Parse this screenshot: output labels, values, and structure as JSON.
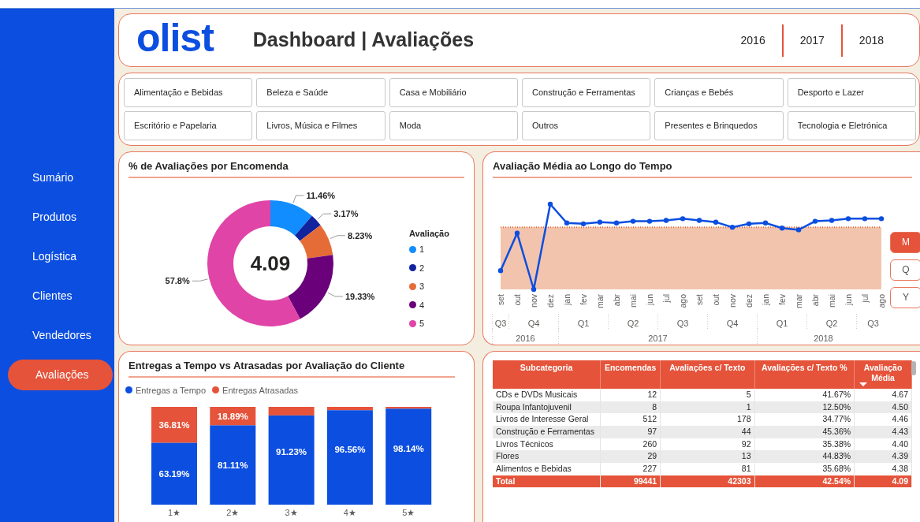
{
  "sidebar": {
    "items": [
      {
        "label": "Sumário",
        "selected": false
      },
      {
        "label": "Produtos",
        "selected": false
      },
      {
        "label": "Logística",
        "selected": false
      },
      {
        "label": "Clientes",
        "selected": false
      },
      {
        "label": "Vendedores",
        "selected": false
      },
      {
        "label": "Avaliações",
        "selected": true
      }
    ]
  },
  "header": {
    "logo": "olist",
    "title": "Dashboard | Avaliações",
    "years": [
      "2016",
      "2017",
      "2018"
    ]
  },
  "categories": [
    "Alimentação e Bebidas",
    "Beleza e Saúde",
    "Casa e Mobiliário",
    "Construção e Ferramentas",
    "Crianças e Bebés",
    "Desporto e Lazer",
    "Escritório e Papelaria",
    "Livros, Música e Filmes",
    "Moda",
    "Outros",
    "Presentes e Brinquedos",
    "Tecnologia e Eletrónica"
  ],
  "reviews_by_order": {
    "title": "% de Avaliações por Encomenda",
    "center_value": "4.09",
    "chart_data": {
      "type": "donut",
      "categories": [
        "1",
        "2",
        "3",
        "4",
        "5"
      ],
      "series": [
        {
          "name": "Avaliação",
          "values": [
            11.46,
            3.17,
            8.23,
            19.33,
            57.8
          ]
        }
      ],
      "colors": [
        "#118dff",
        "#12239e",
        "#e66c37",
        "#6b007b",
        "#e044a7"
      ],
      "value_labels": [
        "11.46%",
        "3.17%",
        "8.23%",
        "19.33%",
        "57.8%"
      ]
    }
  },
  "rating_over_time": {
    "title": "Avaliação Média ao Longo do Tempo",
    "axis": [
      {
        "label": "2016",
        "children": [
          {
            "label": "Q3",
            "children": [
              {
                "label": "set"
              }
            ]
          },
          {
            "label": "Q4",
            "children": [
              {
                "label": "out"
              },
              {
                "label": "nov"
              },
              {
                "label": "dez"
              }
            ]
          }
        ]
      },
      {
        "label": "2017",
        "children": [
          {
            "label": "Q1",
            "children": [
              {
                "label": "jan"
              },
              {
                "label": "fev"
              },
              {
                "label": "mar"
              }
            ]
          },
          {
            "label": "Q2",
            "children": [
              {
                "label": "abr"
              },
              {
                "label": "mai"
              },
              {
                "label": "jun"
              }
            ]
          },
          {
            "label": "Q3",
            "children": [
              {
                "label": "jul"
              },
              {
                "label": "ago"
              },
              {
                "label": "set"
              }
            ]
          },
          {
            "label": "Q4",
            "children": [
              {
                "label": "out"
              },
              {
                "label": "nov"
              },
              {
                "label": "dez"
              }
            ]
          }
        ]
      },
      {
        "label": "2018",
        "children": [
          {
            "label": "Q1",
            "children": [
              {
                "label": "jan"
              },
              {
                "label": "fev"
              },
              {
                "label": "mar"
              }
            ]
          },
          {
            "label": "Q2",
            "children": [
              {
                "label": "abr"
              },
              {
                "label": "mai"
              },
              {
                "label": "jun"
              }
            ]
          },
          {
            "label": "Q3",
            "children": [
              {
                "label": "jul"
              },
              {
                "label": "ago"
              }
            ]
          }
        ]
      }
    ],
    "granularity": [
      {
        "label": "M",
        "selected": true
      },
      {
        "label": "Q",
        "selected": false
      },
      {
        "label": "Y",
        "selected": false
      }
    ]
  },
  "deliveries_by_rating": {
    "title": "Entregas a Tempo vs Atrasadas por Avaliação do Cliente",
    "chart_data": {
      "type": "bar",
      "stacked": true,
      "categories": [
        "1★",
        "2★",
        "3★",
        "4★",
        "5★"
      ],
      "series": [
        {
          "name": "Entregas a Tempo",
          "color": "#0b4ee0",
          "values": [
            63.19,
            81.11,
            91.23,
            96.56,
            98.14
          ],
          "value_labels": [
            "63.19%",
            "81.11%",
            "91.23%",
            "96.56%",
            "98.14%"
          ]
        },
        {
          "name": "Entregas Atrasadas",
          "color": "#e5533a",
          "values": [
            36.81,
            18.89,
            8.77,
            3.44,
            1.86
          ],
          "value_labels": [
            "36.81%",
            "18.89%",
            null,
            null,
            null
          ]
        }
      ]
    }
  },
  "subcategory_table": {
    "columns": [
      {
        "label": "Subcategoria",
        "sorted": false
      },
      {
        "label": "Encomendas",
        "sorted": false
      },
      {
        "label": "Avaliações c/ Texto",
        "sorted": false
      },
      {
        "label": "Avaliações c/ Texto %",
        "sorted": false
      },
      {
        "label": "Avaliação Média",
        "sorted": true
      }
    ],
    "rows": [
      [
        "CDs e DVDs Musicais",
        "12",
        "5",
        "41.67%",
        "4.67"
      ],
      [
        "Roupa Infantojuvenil",
        "8",
        "1",
        "12.50%",
        "4.50"
      ],
      [
        "Livros de Interesse Geral",
        "512",
        "178",
        "34.77%",
        "4.46"
      ],
      [
        "Construção e Ferramentas",
        "97",
        "44",
        "45.36%",
        "4.43"
      ],
      [
        "Livros Técnicos",
        "260",
        "92",
        "35.38%",
        "4.40"
      ],
      [
        "Flores",
        "29",
        "13",
        "44.83%",
        "4.39"
      ],
      [
        "Alimentos e Bebidas",
        "227",
        "81",
        "35.68%",
        "4.38"
      ]
    ],
    "total": [
      "Total",
      "99441",
      "42303",
      "42.54%",
      "4.09"
    ]
  }
}
